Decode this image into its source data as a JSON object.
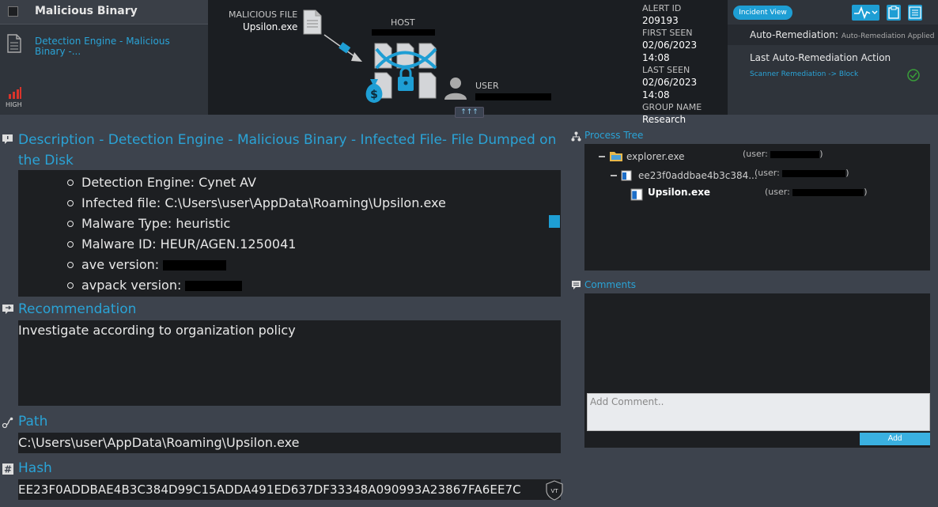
{
  "alert": {
    "title": "Malicious Binary",
    "link": "Detection Engine - Malicious Binary -...",
    "severity": "HIGH"
  },
  "graphic": {
    "malicious_file_label": "MALICIOUS FILE",
    "malicious_file_name": "Upsilon.exe",
    "host_label": "HOST",
    "user_label": "USER"
  },
  "alert_info": {
    "alert_id_label": "ALERT ID",
    "alert_id": "209193",
    "first_seen_label": "FIRST SEEN",
    "first_seen": "02/06/2023 14:08",
    "last_seen_label": "LAST SEEN",
    "last_seen": "02/06/2023 14:08",
    "group_name_label": "GROUP NAME",
    "group_name": "Research"
  },
  "right_panel": {
    "incident_view": "Incident View",
    "auto_remediation_label": "Auto-Remediation:",
    "auto_remediation_value": "Auto-Remediation Applied",
    "last_action_label": "Last Auto-Remediation Action",
    "last_action_link": "Scanner Remediation -> Block"
  },
  "description": {
    "title": "Description - Detection Engine - Malicious Binary - Infected File- File Dumped on the Disk",
    "items": [
      "Detection Engine: Cynet AV",
      "Infected file: C:\\Users\\user\\AppData\\Roaming\\Upsilon.exe",
      "Malware Type: heuristic",
      "Malware ID: HEUR/AGEN.1250041",
      "ave version:",
      "avpack version:"
    ]
  },
  "recommendation": {
    "title": "Recommendation",
    "text": "Investigate according to organization policy"
  },
  "path": {
    "title": "Path",
    "value": "C:\\Users\\user\\AppData\\Roaming\\Upsilon.exe"
  },
  "hash": {
    "title": "Hash",
    "value": "EE23F0ADDBAE4B3C384D99C15ADDA491ED637DF33348A090993A23867FA6EE7C",
    "vt_label": "VT"
  },
  "process_tree": {
    "title": "Process Tree",
    "user_prefix": "(user:",
    "nodes": [
      {
        "name": "explorer.exe"
      },
      {
        "name": "ee23f0addbae4b3c384..."
      },
      {
        "name": "Upsilon.exe"
      }
    ]
  },
  "comments": {
    "title": "Comments",
    "placeholder": "Add Comment..",
    "add_label": "Add"
  },
  "colors": {
    "accent": "#1e9ed4",
    "link": "#2aa3d6",
    "severity": "#d9342b"
  }
}
